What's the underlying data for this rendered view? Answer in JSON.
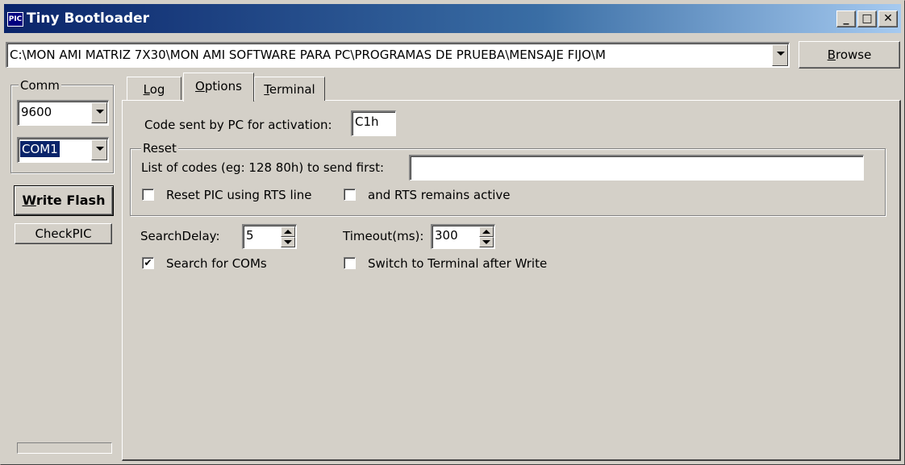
{
  "window": {
    "title": "Tiny Bootloader",
    "icon_text": "PIC",
    "minimize": "_",
    "maximize": "□",
    "close": "✕"
  },
  "file_path": {
    "value": "C:\\MON AMI MATRIZ 7X30\\MON AMI SOFTWARE PARA PC\\PROGRAMAS DE PRUEBA\\MENSAJE FIJO\\M",
    "browse_label": "Browse",
    "browse_hotkey": "B",
    "browse_rest": "rowse"
  },
  "comm": {
    "group_label": "Comm",
    "baud": "9600",
    "port": "COM1"
  },
  "buttons": {
    "write_flash_hotkey": "W",
    "write_flash_rest": "rite Flash",
    "checkpic": "CheckPIC"
  },
  "tabs": [
    {
      "hotkey": "L",
      "rest": "og"
    },
    {
      "hotkey": "O",
      "rest": "ptions"
    },
    {
      "hotkey": "T",
      "rest": "erminal"
    }
  ],
  "options": {
    "activation_label": "Code sent by PC for activation:",
    "activation_value": "C1h",
    "reset_group": "Reset",
    "codes_label": "List of codes (eg: 128  80h) to send first:",
    "codes_value": "",
    "reset_rts_label": "Reset PIC using RTS line",
    "reset_rts_checked": false,
    "rts_active_label": "and RTS remains active",
    "rts_active_checked": false,
    "search_delay_label": "SearchDelay:",
    "search_delay_value": "5",
    "timeout_label": "Timeout(ms):",
    "timeout_value": "300",
    "search_coms_label": "Search for COMs",
    "search_coms_checked": true,
    "switch_terminal_label": "Switch to Terminal after Write",
    "switch_terminal_checked": false,
    "check_mark": "✔"
  },
  "colors": {
    "title_bar_start": "#0a246a",
    "title_bar_end": "#a6caf0",
    "face": "#d4d0c8",
    "selection": "#0a246a"
  },
  "progress": 0
}
